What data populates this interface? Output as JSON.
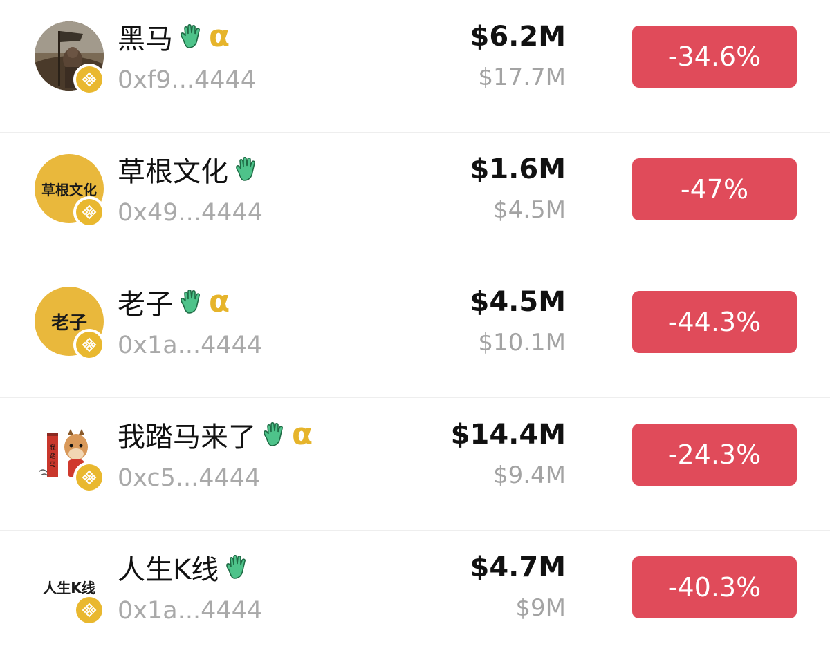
{
  "colors": {
    "negative": "#e04b5a",
    "badge": "#e9b82f",
    "alpha": "#e6b42b",
    "hand": "#4ec38a",
    "muted": "#a9a9a9"
  },
  "tokens": [
    {
      "name": "黑马",
      "address": "0xf9...4444",
      "market_cap": "$6.2M",
      "volume": "$17.7M",
      "change": "-34.6%",
      "icons": [
        "hand-icon",
        "alpha-icon"
      ],
      "avatar_text": "",
      "avatar_bg": "#6b5a45"
    },
    {
      "name": "草根文化",
      "address": "0x49...4444",
      "market_cap": "$1.6M",
      "volume": "$4.5M",
      "change": "-47%",
      "icons": [
        "hand-icon"
      ],
      "avatar_text": "草根文化",
      "avatar_bg": "#e9b83c"
    },
    {
      "name": "老子",
      "address": "0x1a...4444",
      "market_cap": "$4.5M",
      "volume": "$10.1M",
      "change": "-44.3%",
      "icons": [
        "hand-icon",
        "alpha-icon"
      ],
      "avatar_text": "老子",
      "avatar_bg": "#e9b83c"
    },
    {
      "name": "我踏马来了",
      "address": "0xc5...4444",
      "market_cap": "$14.4M",
      "volume": "$9.4M",
      "change": "-24.3%",
      "icons": [
        "hand-icon",
        "alpha-icon"
      ],
      "avatar_text": "",
      "avatar_bg": "#ffffff"
    },
    {
      "name": "人生K线",
      "address": "0x1a...4444",
      "market_cap": "$4.7M",
      "volume": "$9M",
      "change": "-40.3%",
      "icons": [
        "hand-icon"
      ],
      "avatar_text": "人生K线",
      "avatar_bg": "#ffffff"
    }
  ]
}
